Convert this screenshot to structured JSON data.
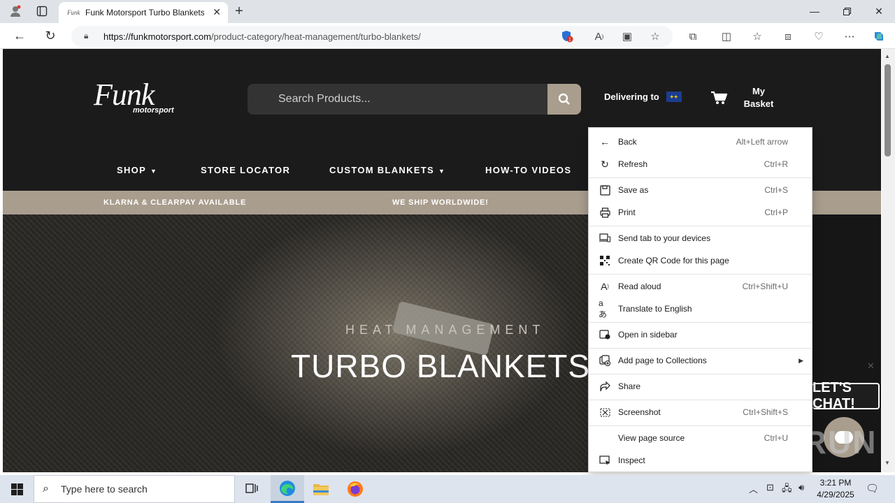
{
  "browser": {
    "tab_title": "Funk Motorsport Turbo Blankets",
    "tab_favicon_text": "Funk",
    "url_host": "https://funkmotorsport.com",
    "url_path": "/product-category/heat-management/turbo-blankets/",
    "notification_badge": "1"
  },
  "site": {
    "logo_main": "Funk",
    "logo_sub": "motorsport",
    "search_placeholder": "Search Products...",
    "delivering_label": "Delivering to",
    "basket_line1": "My",
    "basket_line2": "Basket",
    "nav": [
      {
        "label": "SHOP",
        "has_caret": true
      },
      {
        "label": "STORE LOCATOR",
        "has_caret": false
      },
      {
        "label": "CUSTOM BLANKETS",
        "has_caret": true
      },
      {
        "label": "HOW-TO VIDEOS",
        "has_caret": false
      }
    ],
    "promo": [
      "KLARNA & CLEARPAY AVAILABLE",
      "WE SHIP WORLDWIDE!"
    ],
    "hero_subtitle": "HEAT MANAGEMENT",
    "hero_title": "TURBO BLANKETS",
    "chat_text": "LET'S CHAT!"
  },
  "context_menu": {
    "items": [
      {
        "icon": "back-arrow-icon",
        "label": "Back",
        "shortcut": "Alt+Left arrow"
      },
      {
        "icon": "refresh-icon",
        "label": "Refresh",
        "shortcut": "Ctrl+R"
      },
      {
        "icon": "save-icon",
        "label": "Save as",
        "shortcut": "Ctrl+S"
      },
      {
        "icon": "print-icon",
        "label": "Print",
        "shortcut": "Ctrl+P"
      },
      {
        "icon": "send-tab-icon",
        "label": "Send tab to your devices",
        "shortcut": ""
      },
      {
        "icon": "qr-code-icon",
        "label": "Create QR Code for this page",
        "shortcut": ""
      },
      {
        "icon": "read-aloud-icon",
        "label": "Read aloud",
        "shortcut": "Ctrl+Shift+U"
      },
      {
        "icon": "translate-icon",
        "label": "Translate to English",
        "shortcut": ""
      },
      {
        "icon": "sidebar-icon",
        "label": "Open in sidebar",
        "shortcut": ""
      },
      {
        "icon": "collections-icon",
        "label": "Add page to Collections",
        "shortcut": ""
      },
      {
        "icon": "share-icon",
        "label": "Share",
        "shortcut": ""
      },
      {
        "icon": "screenshot-icon",
        "label": "Screenshot",
        "shortcut": "Ctrl+Shift+S"
      },
      {
        "icon": "",
        "label": "View page source",
        "shortcut": "Ctrl+U"
      },
      {
        "icon": "inspect-icon",
        "label": "Inspect",
        "shortcut": ""
      }
    ]
  },
  "taskbar": {
    "search_placeholder": "Type here to search",
    "time": "3:21 PM",
    "date": "4/29/2025"
  },
  "watermark": "ANY.RUN",
  "colors": {
    "accent_tan": "#a99d8e",
    "site_bg": "#1b1b1b",
    "taskbar_bg": "#dde4ee"
  }
}
